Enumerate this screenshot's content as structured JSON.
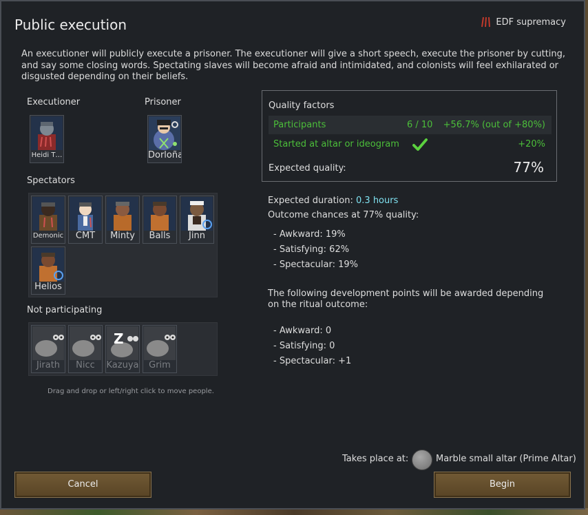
{
  "dialog": {
    "title": "Public execution",
    "faction_label": "EDF supremacy",
    "description": "An executioner will publicly execute a prisoner. The executioner will give a short speech, execute the prisoner by cutting, and say some closing words. Spectating slaves will become afraid and intimidated, and colonists will feel exhilarated or disgusted depending on their beliefs."
  },
  "roles": {
    "executioner_label": "Executioner",
    "executioner": "Heidi T…",
    "prisoner_label": "Prisoner",
    "prisoner": "Dorloña"
  },
  "spectators": {
    "label": "Spectators",
    "items": [
      "Demonic",
      "CMT",
      "Minty",
      "Balls",
      "Jinn",
      "Helios"
    ]
  },
  "not_participating": {
    "label": "Not participating",
    "items": [
      "Jirath",
      "Nicc",
      "Kazuya",
      "Grim"
    ],
    "sleeping_marker": "Z"
  },
  "hint": "Drag and drop or left/right click to move people.",
  "quality": {
    "title": "Quality factors",
    "participants_label": "Participants",
    "participants_count": "6 / 10",
    "participants_value": "+56.7% (out of +80%)",
    "altar_label": "Started at altar or ideogram",
    "altar_value": "+20%",
    "expected_label": "Expected quality:",
    "expected_value": "77%"
  },
  "duration": {
    "label": "Expected duration:",
    "value": "0.3 hours"
  },
  "outcome": {
    "title": "Outcome chances at 77% quality:",
    "lines": [
      "- Awkward: 19%",
      "- Satisfying: 62%",
      "- Spectacular: 19%"
    ]
  },
  "development": {
    "title_line1": "The following development points will be awarded depending",
    "title_line2": "on the ritual outcome:",
    "lines": [
      "- Awkward: 0",
      "- Satisfying: 0",
      "- Spectacular: +1"
    ]
  },
  "location": {
    "label": "Takes place at:",
    "name": "Marble small altar (Prime Altar)"
  },
  "buttons": {
    "cancel": "Cancel",
    "begin": "Begin"
  },
  "colors": {
    "positive": "#4cbf3a",
    "highlight": "#7fe1f0",
    "button": "#705934"
  }
}
